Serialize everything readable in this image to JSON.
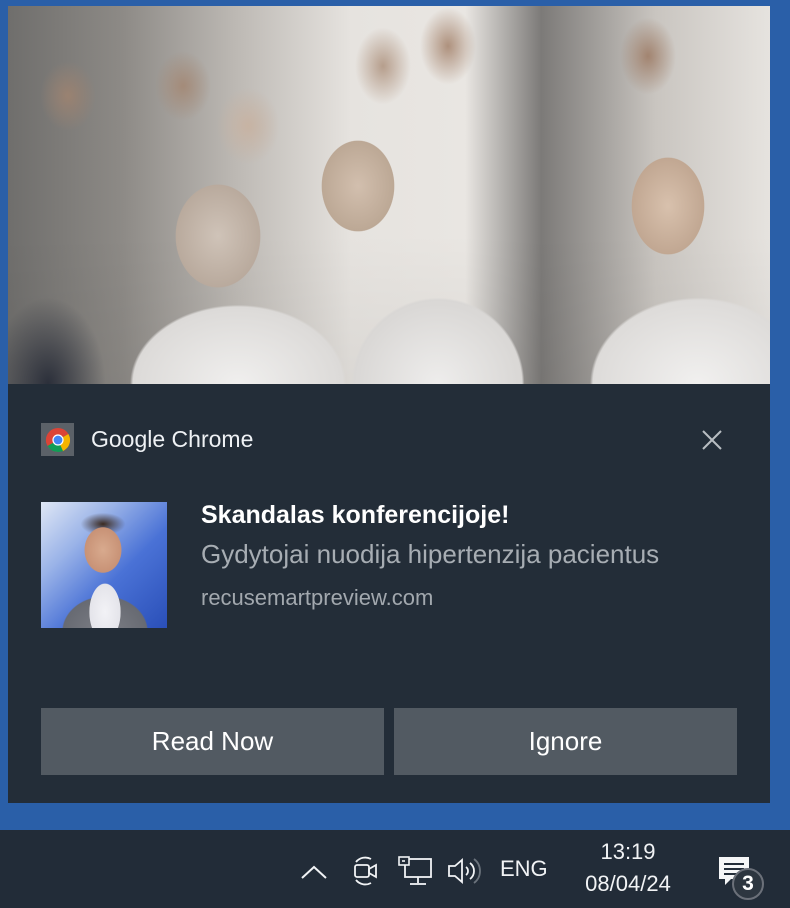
{
  "notification": {
    "app_name": "Google Chrome",
    "app_icon": "chrome-icon",
    "close_icon": "close-icon",
    "hero_image": "doctors-press-conference-photo",
    "thumbnail_image": "news-presenter-photo",
    "title": "Skandalas konferencijoje!",
    "body": "Gydytojai nuodija hipertenzija pacientus",
    "source": "recusemartpreview.com",
    "actions": [
      {
        "label": "Read Now"
      },
      {
        "label": "Ignore"
      }
    ]
  },
  "taskbar": {
    "tray_icons": [
      "chevron-up-icon",
      "meet-now-icon",
      "network-icon",
      "volume-icon"
    ],
    "language": "ENG",
    "time": "13:19",
    "date": "08/04/24",
    "action_center_icon": "action-center-icon",
    "notification_count": "3"
  },
  "colors": {
    "accent_border": "#2a5fa8",
    "toast_background": "#232d38",
    "button_background": "#525a62",
    "taskbar_background": "#222c38"
  }
}
